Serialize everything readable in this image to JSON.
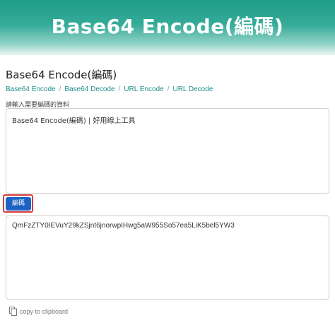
{
  "header": {
    "title": "Base64 Encode(編碼)"
  },
  "page": {
    "heading": "Base64 Encode(編碼)"
  },
  "breadcrumb": {
    "items": [
      "Base64 Encode",
      "Base64 Decode",
      "URL Encode",
      "URL Decode"
    ],
    "separator": "/"
  },
  "form": {
    "input_label": "請輸入需要編碼的資料",
    "input_value": "Base64 Encode(編碼) | 好用線上工具",
    "encode_button": "編碼",
    "output_value": "QmFzZTY0IEVuY29kZSjnt6jnorwpIHwg5aW955So57ea5LiK5bel5YW3",
    "copy_label": "copy to clipboard"
  },
  "colors": {
    "header_gradient_top": "#1f9e8a",
    "link": "#1f8f8b",
    "button": "#1d63c6",
    "highlight_frame": "#d9383c"
  }
}
